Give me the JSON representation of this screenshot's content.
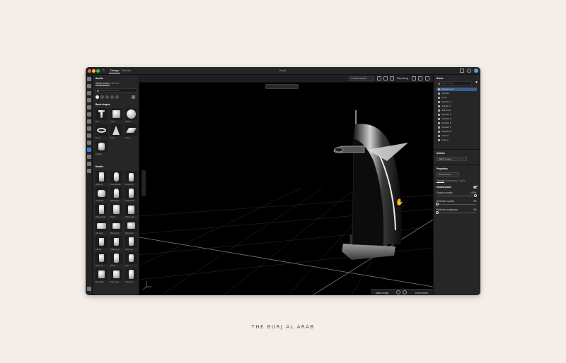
{
  "window": {
    "title": "Burj1",
    "tabs": [
      "Design",
      "Render"
    ]
  },
  "left_panel": {
    "title": "Assets",
    "tabs": [
      "Starter assets",
      "Libraries"
    ],
    "search_placeholder": "Search starter assets",
    "basic_shapes": {
      "title": "Basic shapes",
      "items": [
        "Text",
        "Cube",
        "Sphere",
        "Torus",
        "Cone",
        "Plane",
        "Cylinder"
      ]
    },
    "models": {
      "title": "Models",
      "items": [
        "Bottle sq",
        "Round bottle",
        "Pump bot",
        "Jar plastic",
        "Wine glass",
        "Soap bottle",
        "Spray bottle",
        "Pouch",
        "Pillow pack",
        "Gift wrap",
        "Money box",
        "Paper box",
        "Cup lid",
        "Coffee cup",
        "Drink cup",
        "Latte cup",
        "Flask",
        "Can",
        "Bag with h",
        "Paper bag",
        "Shampoo"
      ]
    }
  },
  "viewport": {
    "camera_label": "Untitled Camera",
    "ray_tracing_label": "Ray tracing",
    "bottom_bar": {
      "match_image_label": "Match image",
      "environment_label": "Environment"
    }
  },
  "right_panel": {
    "scene": {
      "title": "Scene",
      "search_placeholder": "Search scene",
      "layers": [
        "Environment",
        "Cylinder",
        "Cone",
        "Cylinder 4",
        "Cylinder 2",
        "Half Cone",
        "Cylinder 5",
        "Cylinder 3",
        "Cylinder 6",
        "Cylinder 7",
        "Cylinder 8",
        "Cube 3",
        "Cube 2"
      ]
    },
    "actions": {
      "title": "Actions",
      "match_image_label": "Match image..."
    },
    "properties": {
      "title": "Properties",
      "environment_button": "Environment",
      "tabs": [
        "General",
        "Background",
        "Lights"
      ],
      "section": "Ground plane",
      "shadow_opacity_label": "Shadow opacity",
      "shadow_opacity_value": "100%",
      "reflection_opacity_label": "Reflection opacity",
      "reflection_opacity_value": "0%",
      "reflection_roughness_label": "Reflection roughness",
      "reflection_roughness_value": "0%"
    }
  },
  "caption": "THE BURJ AL ARAB",
  "colors": {
    "page_bg": "#f5ede7",
    "accent": "#2f7de1",
    "selection": "#3a5f8f"
  }
}
